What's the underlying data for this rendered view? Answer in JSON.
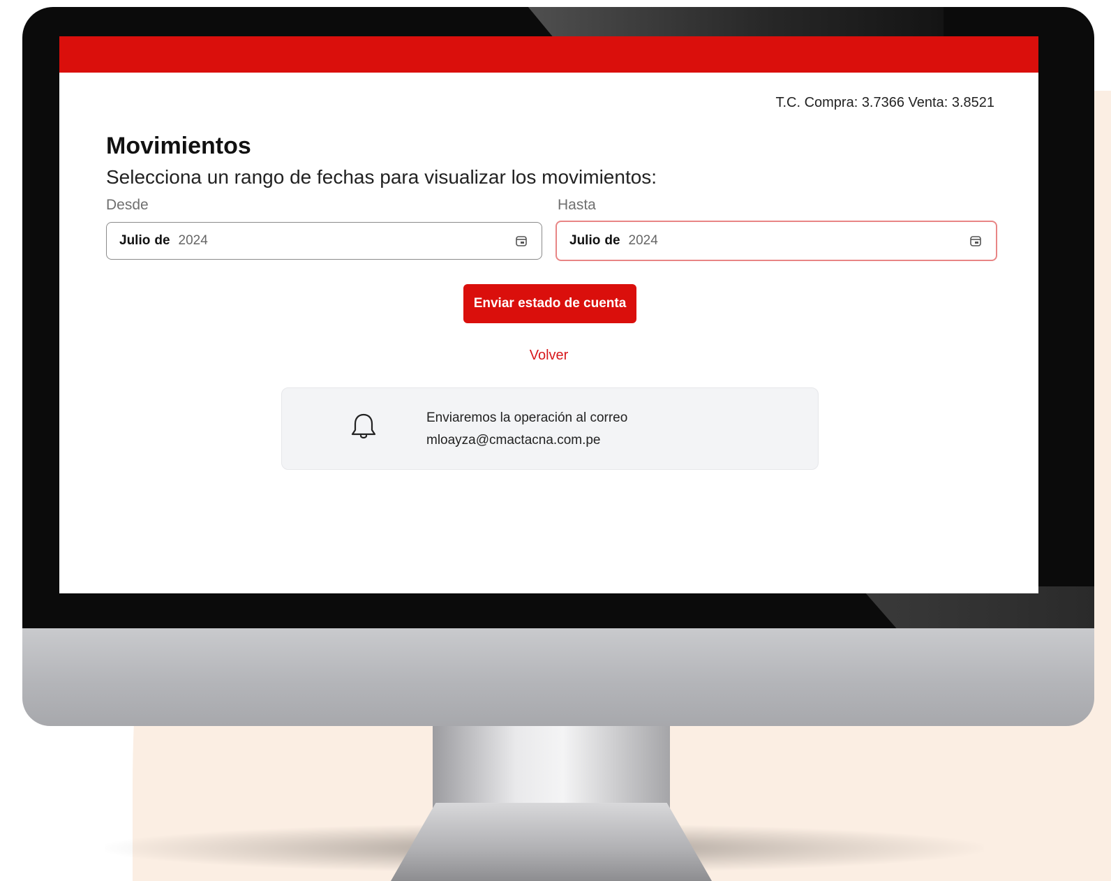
{
  "header": {
    "exchange_rate": "T.C. Compra: 3.7366 Venta: 3.8521",
    "accent_color": "#da0f0c"
  },
  "main": {
    "title": "Movimientos",
    "subtitle": "Selecciona un rango de fechas para visualizar los movimientos:",
    "from": {
      "label": "Desde",
      "month": "Julio",
      "connector": "de",
      "year": "2024",
      "icon": "calendar-icon"
    },
    "to": {
      "label": "Hasta",
      "month": "Julio",
      "connector": "de",
      "year": "2024",
      "icon": "calendar-icon",
      "focus_color": "#e88585"
    },
    "send_button": "Enviar estado de cuenta",
    "back_link": "Volver",
    "notice": {
      "icon": "bell-icon",
      "line1": "Enviaremos la operación al correo",
      "email": "mloayza@cmactacna.com.pe"
    }
  }
}
